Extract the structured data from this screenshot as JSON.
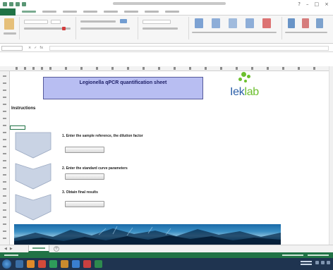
{
  "window": {
    "title": ""
  },
  "ribbon": {
    "tabs": [
      "",
      "",
      "",
      "",
      "",
      "",
      "",
      "",
      ""
    ]
  },
  "formula_bar": {
    "name_box": "",
    "content": ""
  },
  "sheet": {
    "title": {
      "line1": "Legionella qPCR quantification sheet",
      "line2": "",
      "line3": ""
    },
    "logo": {
      "text_main": "Iek",
      "text_accent": "lab"
    },
    "instructions_heading": "Instructions",
    "instructions_text": "",
    "steps": [
      {
        "number": "1.",
        "caption": "",
        "description": "Enter the sample reference, the dilution factor",
        "button": ""
      },
      {
        "number": "2.",
        "caption": "",
        "description": "Enter the standard curve parameters",
        "button": ""
      },
      {
        "number": "3.",
        "caption": "",
        "description": "Obtain final results",
        "button": ""
      }
    ]
  },
  "sheet_tabs": {
    "active": ""
  },
  "colors": {
    "excel_green": "#217346",
    "title_fill": "#b8bef2",
    "title_border": "#55599a",
    "logo_blue": "#2b5fa8",
    "logo_green": "#6cbf2e",
    "chevron_fill": "#c9d3e4",
    "taskbar": "#1f3450"
  },
  "icons": [
    "excel-logo-icon",
    "save-icon",
    "undo-icon",
    "redo-icon",
    "minimize-icon",
    "maximize-icon",
    "close-icon",
    "windows-start-icon"
  ]
}
